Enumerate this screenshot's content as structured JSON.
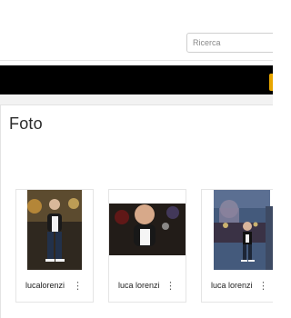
{
  "search": {
    "placeholder": "Ricerca"
  },
  "section": {
    "title": "Foto"
  },
  "photos": [
    {
      "author": "lucalorenzi"
    },
    {
      "author": "luca lorenzi"
    },
    {
      "author": "luca lorenzi"
    }
  ],
  "icons": {
    "more": "kebab-icon"
  },
  "colors": {
    "header_band": "#000000",
    "accent_tab": "#e8a600"
  }
}
